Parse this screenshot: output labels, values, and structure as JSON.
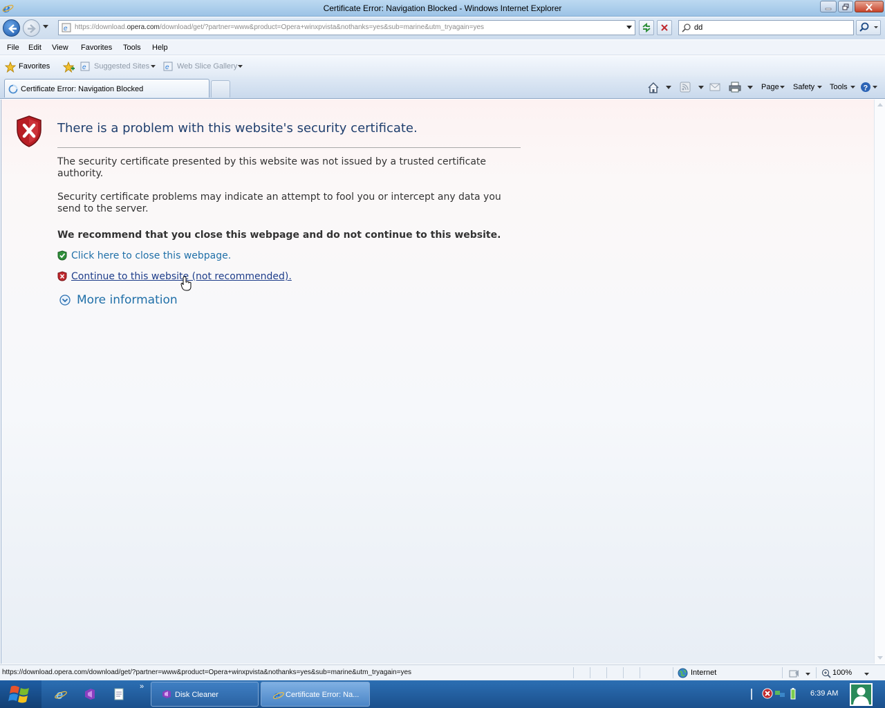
{
  "window": {
    "title": "Certificate Error: Navigation Blocked - Windows Internet Explorer"
  },
  "address": {
    "url_prefix": "https://download.",
    "url_domain": "opera.com",
    "url_suffix": "/download/get/?partner=www&product=Opera+winxpvista&nothanks=yes&sub=marine&utm_tryagain=yes",
    "search_value": "dd"
  },
  "menu": {
    "items": [
      "File",
      "Edit",
      "View",
      "Favorites",
      "Tools",
      "Help"
    ]
  },
  "favorites": {
    "favorites_label": "Favorites",
    "suggested_sites": "Suggested Sites",
    "web_slice_gallery": "Web Slice Gallery"
  },
  "tabs": {
    "active_label": "Certificate Error: Navigation Blocked"
  },
  "command_bar": {
    "page": "Page",
    "safety": "Safety",
    "tools": "Tools"
  },
  "content": {
    "heading": "There is a problem with this website's security certificate.",
    "para1": "The security certificate presented by this website was not issued by a trusted certificate authority.",
    "para2": "Security certificate problems may indicate an attempt to fool you or intercept any data you send to the server.",
    "recommend": "We recommend that you close this webpage and do not continue to this website.",
    "close_link": "Click here to close this webpage.",
    "continue_link": "Continue to this website (not recommended).",
    "more_info": "More information"
  },
  "status": {
    "url": "https://download.opera.com/download/get/?partner=www&product=Opera+winxpvista&nothanks=yes&sub=marine&utm_tryagain=yes",
    "zone": "Internet",
    "zoom": "100%"
  },
  "taskbar": {
    "disk_cleaner": "Disk Cleaner",
    "ie_button": "Certificate Error: Na...",
    "clock": "6:39 AM"
  },
  "colors": {
    "heading": "#1f3f6e",
    "link": "#1f6fa8",
    "error_red": "#c0282d",
    "safe_green": "#2f8f3a"
  }
}
